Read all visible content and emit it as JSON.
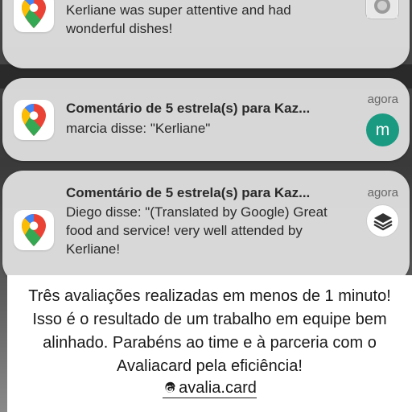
{
  "notifications": [
    {
      "title": "",
      "body": "Kerliane was super attentive and had wonderful dishes!",
      "time": "",
      "app_icon": "google-maps-pin-icon",
      "avatar": "photo"
    },
    {
      "title": "Comentário de 5 estrela(s) para Kaz...",
      "body": "marcia disse: \"Kerliane\"",
      "time": "agora",
      "app_icon": "google-maps-pin-icon",
      "avatar": "m",
      "avatar_color": "#1b9a82"
    },
    {
      "title": "Comentário de 5 estrela(s) para Kaz...",
      "body": "Diego disse: \"(Translated by Google) Great food and service! very well attended by Kerliane!",
      "time": "agora",
      "app_icon": "google-maps-pin-icon",
      "avatar": "layers-logo-icon"
    }
  ],
  "caption": {
    "text": "Três avaliações realizadas em menos de 1 minuto! Isso é o resultado de um trabalho em equipe bem alinhado. Parabéns ao time e à parceria com o Avaliacard pela eficiência!",
    "handle": "avalia.card",
    "handle_icon": "threads-icon"
  }
}
